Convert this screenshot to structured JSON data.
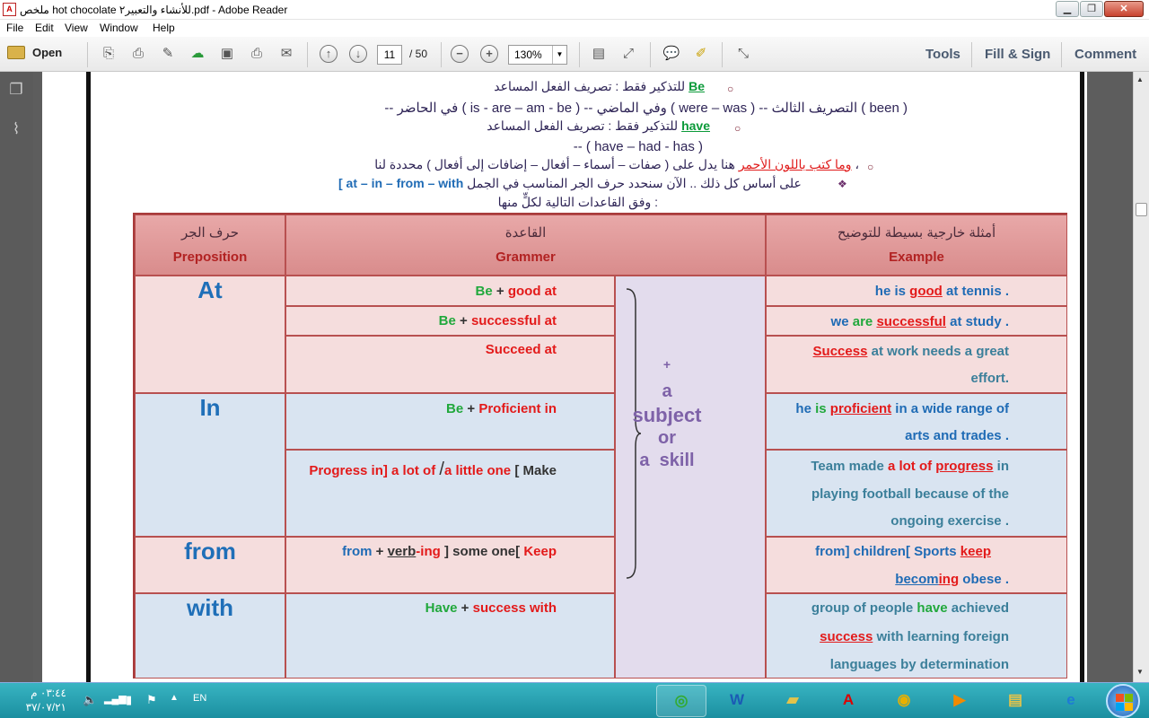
{
  "window": {
    "title": "ملخص hot chocolate للأنشاء والتعبير٢.pdf - Adobe Reader",
    "app_icon": "pdf-icon",
    "controls": [
      "minimize",
      "maximize",
      "close"
    ]
  },
  "menu": [
    "File",
    "Edit",
    "View",
    "Window",
    "Help"
  ],
  "toolbar": {
    "open_label": "Open",
    "page_current": "11",
    "page_total": "/ 50",
    "zoom": "130%",
    "right_tabs": [
      "Tools",
      "Fill & Sign",
      "Comment"
    ]
  },
  "doc": {
    "lines": [
      {
        "p1": "للتذكير فقط : تصريف الفعل المساعد ",
        "g": "Be"
      },
      {
        "t": "-- في الحاضر ( is - are – am - be )  -- وفي الماضي ( were – was )  -- التصريف الثالث ( been )"
      },
      {
        "p1": "للتذكير فقط : تصريف الفعل المساعد ",
        "g": "have"
      },
      {
        "t": "-- ( have – had - has )"
      },
      {
        "r": "وما كتب باللون الأحمر",
        "t": " هنا يدل على ( صفات – أسماء – أفعال – إضافات إلى أفعال ) محددة لنا ،"
      },
      {
        "t": "على أساس كل ذلك .. الآن سنحدد حرف الجر المناسب في الجمل",
        "b": "[ at – in – from – with"
      },
      {
        "t": "وفق القاعدات التالية لكلٍّ منها :"
      }
    ]
  },
  "table": {
    "headers": [
      {
        "ar": "حرف الجر",
        "en": "Preposition"
      },
      {
        "ar": "القاعدة",
        "en": "Grammer"
      },
      {
        "ar": "أمثلة خارجية بسيطة للتوضيح",
        "en": "Example"
      }
    ],
    "preps": [
      "At",
      "In",
      "from",
      "with"
    ],
    "brace": [
      "+",
      "a",
      "subject",
      "or",
      "a  skill"
    ],
    "rules": {
      "at1": [
        "Be",
        "+",
        "good at"
      ],
      "at2": [
        "Be",
        "+",
        "successful at"
      ],
      "at3": [
        "Succeed at"
      ],
      "in1": [
        "Be",
        "+",
        "Proficient in"
      ],
      "in2": [
        "Progress in]",
        "a lot of",
        "/",
        "a little one",
        "[ Make"
      ],
      "from": [
        "from",
        "+",
        "verb",
        "-ing",
        "] some one[",
        "Keep"
      ],
      "with": [
        "Have",
        "+",
        "success with"
      ]
    },
    "examples": {
      "at1": [
        "he is ",
        "good",
        " at tennis ."
      ],
      "at2": [
        "we ",
        "are ",
        "successful",
        " at study ."
      ],
      "at3": [
        "Success",
        " at work needs a great",
        "effort."
      ],
      "in1": [
        "he ",
        "is ",
        "proficient",
        " in a wide range of",
        "arts and trades ."
      ],
      "in2": [
        "Team made ",
        "a lot of ",
        "progress",
        " in",
        "playing football because of the",
        "ongoing exercise ."
      ],
      "from": [
        "from] children[ Sports ",
        "keep",
        "becom",
        "ing",
        " obese ."
      ],
      "with": [
        "group of people ",
        "have",
        " achieved",
        "success",
        " with learning foreign",
        "languages by determination"
      ]
    }
  },
  "taskbar": {
    "time": "٠٣:٤٤ م",
    "date": "٣٧/٠٧/٢١",
    "lang": "EN",
    "apps": [
      "camtasia-icon",
      "word-icon",
      "folder-icon",
      "acrobat-icon",
      "chrome-icon",
      "media-player-icon",
      "explorer-icon",
      "ie-icon"
    ]
  },
  "colors": {
    "header_bg": "#d98c8c",
    "pink_row": "#f5dddd",
    "blue_row": "#d9e4f1",
    "purple_col": "#e3dced",
    "green": "#21a83c",
    "red": "#e31a1a",
    "blue": "#1f6bb5"
  }
}
